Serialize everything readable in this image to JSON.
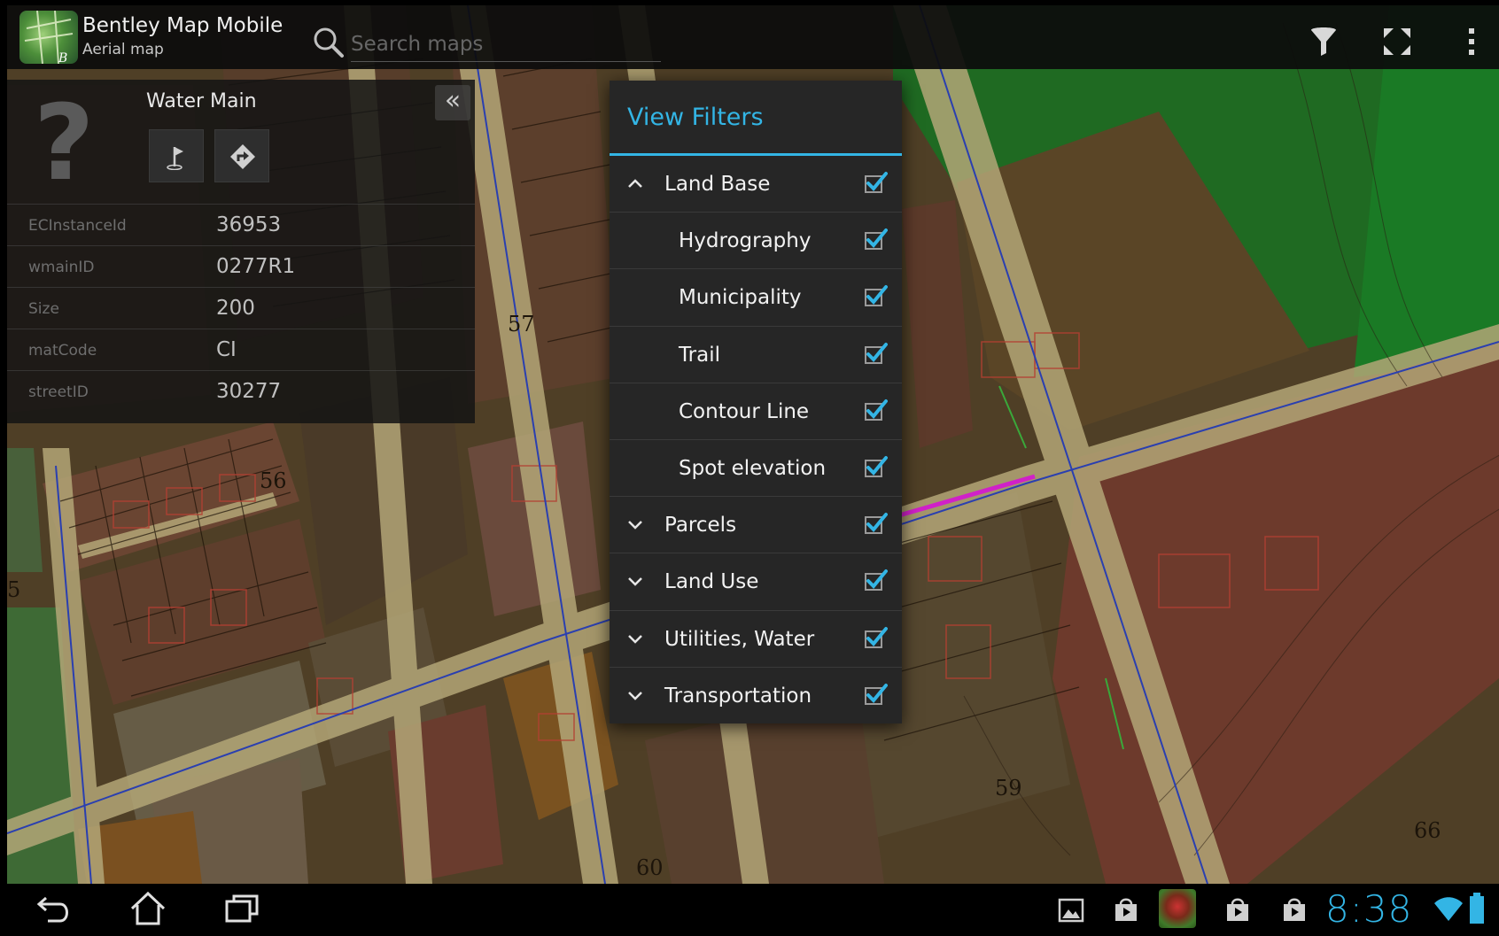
{
  "app": {
    "title": "Bentley Map Mobile",
    "subtitle": "Aerial map",
    "search_placeholder": "Search maps"
  },
  "map": {
    "labels": [
      "57",
      "56",
      "5",
      "59",
      "60",
      "66"
    ]
  },
  "info_panel": {
    "title": "Water Main",
    "attributes": [
      {
        "name": "ECInstanceId",
        "value": "36953"
      },
      {
        "name": "wmainID",
        "value": "0277R1"
      },
      {
        "name": "Size",
        "value": "200"
      },
      {
        "name": "matCode",
        "value": "CI"
      },
      {
        "name": "streetID",
        "value": "30277"
      }
    ]
  },
  "filters": {
    "title": "View Filters",
    "accent": "#33b5e5",
    "items": [
      {
        "label": "Land Base",
        "level": "top",
        "expanded": true,
        "checked": true
      },
      {
        "label": "Hydrography",
        "level": "sub",
        "checked": true
      },
      {
        "label": "Municipality",
        "level": "sub",
        "checked": true
      },
      {
        "label": "Trail",
        "level": "sub",
        "checked": true
      },
      {
        "label": "Contour Line",
        "level": "sub",
        "checked": true
      },
      {
        "label": "Spot elevation",
        "level": "sub",
        "checked": true
      },
      {
        "label": "Parcels",
        "level": "top",
        "expanded": false,
        "checked": true
      },
      {
        "label": "Land Use",
        "level": "top",
        "expanded": false,
        "checked": true
      },
      {
        "label": "Utilities, Water",
        "level": "top",
        "expanded": false,
        "checked": true
      },
      {
        "label": "Transportation",
        "level": "top",
        "expanded": false,
        "checked": true
      }
    ]
  },
  "statusbar": {
    "clock": "8:38"
  },
  "icons": {
    "search": "search-icon",
    "filter": "filter-icon",
    "fullscreen": "fullscreen-icon",
    "overflow": "overflow-menu-icon",
    "flag": "flag-icon",
    "directions": "directions-icon",
    "back": "back-icon",
    "home": "home-icon",
    "recents": "recent-apps-icon"
  }
}
